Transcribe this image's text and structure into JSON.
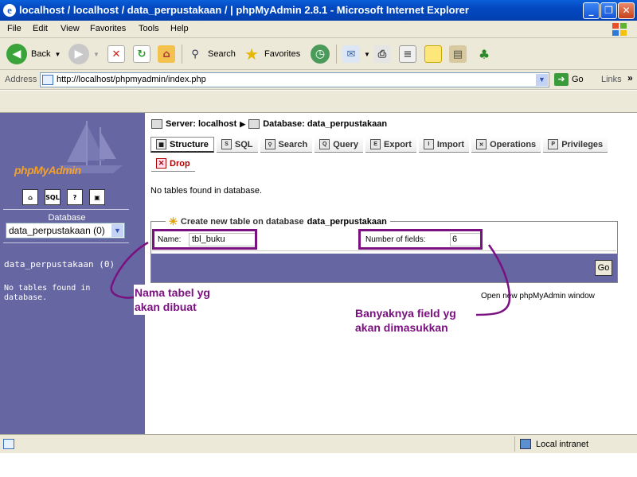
{
  "window": {
    "title": "localhost / localhost / data_perpustakaan / | phpMyAdmin 2.8.1 - Microsoft Internet Explorer",
    "minimize": "_",
    "maximize": "❐",
    "close": "✕"
  },
  "menu": [
    "File",
    "Edit",
    "View",
    "Favorites",
    "Tools",
    "Help"
  ],
  "toolbar": {
    "back": "Back",
    "search": "Search",
    "favorites": "Favorites"
  },
  "address": {
    "label": "Address",
    "url": "http://localhost/phpmyadmin/index.php",
    "go": "Go",
    "links": "Links"
  },
  "left": {
    "logo_text": "phpMyAdmin",
    "icons": [
      "home-icon",
      "sql-icon",
      "help-icon",
      "query-window-icon"
    ],
    "database_label": "Database",
    "database_selected": "data_perpustakaan (0)",
    "db_link": "data_perpustakaan (0)",
    "no_tables": "No tables found in database."
  },
  "main": {
    "breadcrumb": {
      "server": "Server: localhost",
      "database": "Database: data_perpustakaan"
    },
    "tabs": [
      "Structure",
      "SQL",
      "Search",
      "Query",
      "Export",
      "Import",
      "Operations",
      "Privileges"
    ],
    "drop": "Drop",
    "message": "No tables found in database.",
    "create": {
      "legend_prefix": "Create new table on database",
      "legend_db": "data_perpustakaan",
      "name_label": "Name:",
      "name_value": "tbl_buku",
      "fields_label": "Number of fields:",
      "fields_value": "6",
      "go": "Go"
    },
    "open_window": "Open new phpMyAdmin window"
  },
  "annotations": {
    "name_note_1": "Nama  tabel yg",
    "name_note_2": "akan dibuat",
    "fields_note_1": "Banyaknya field yg",
    "fields_note_2": "akan dimasukkan",
    "color": "#7b1080"
  },
  "status": {
    "zone": "Local intranet"
  }
}
